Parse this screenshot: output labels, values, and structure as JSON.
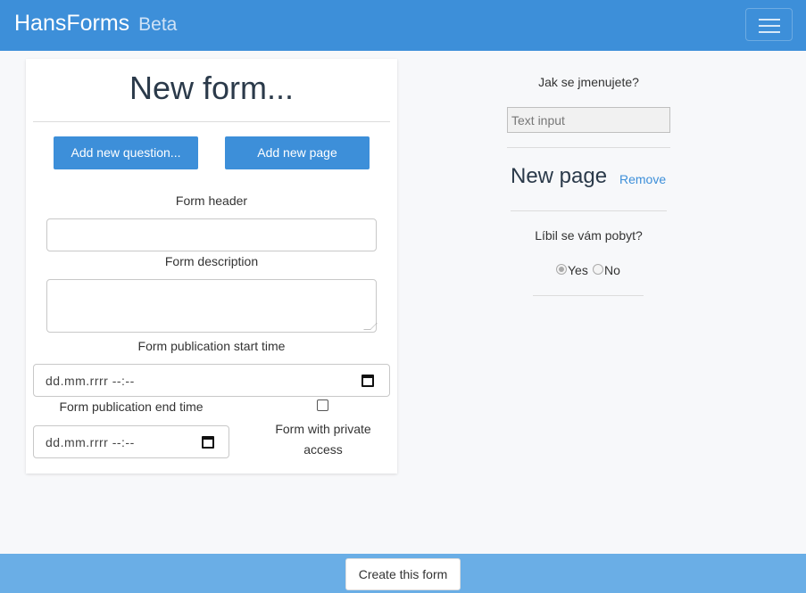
{
  "navbar": {
    "brand": "HansForms",
    "badge": "Beta",
    "menu_icon": "hamburger-icon",
    "color": "#3d8fd9"
  },
  "form_card": {
    "title": "New form...",
    "add_question_label": "Add new question...",
    "add_page_label": "Add new page",
    "header_label": "Form header",
    "header_value": "",
    "description_label": "Form description",
    "description_value": "",
    "start_label": "Form publication start time",
    "start_value": "dd.mm.rrrr --:--",
    "end_label": "Form publication end time",
    "end_value": "dd.mm.rrrr --:--",
    "private_label": "Form with private access",
    "private_checked": false
  },
  "preview": {
    "question1": "Jak se jmenujete?",
    "text_placeholder": "Text input",
    "page_title": "New page",
    "remove_label": "Remove",
    "question2": "Líbil se vám pobyt?",
    "options": [
      "Yes",
      "No"
    ],
    "selected_option": "Yes"
  },
  "footer": {
    "create_label": "Create this form",
    "color": "#6aaee6"
  }
}
